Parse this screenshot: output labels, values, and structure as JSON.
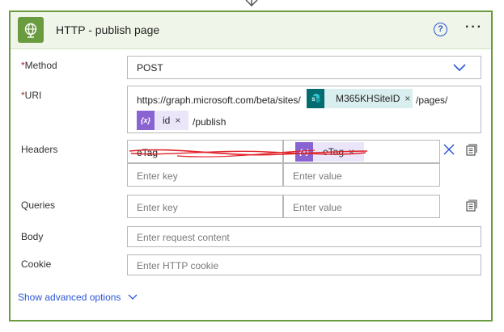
{
  "card": {
    "title": "HTTP - publish page",
    "help_symbol": "?",
    "more_symbol": "···"
  },
  "method": {
    "label": "Method",
    "required_mark": "*",
    "value": "POST"
  },
  "uri": {
    "label": "URI",
    "required_mark": "*",
    "prefix": "https://graph.microsoft.com/beta/sites/",
    "token1": {
      "icon": "sharepoint-icon",
      "text": "M365KHSiteID"
    },
    "middle": "/pages/",
    "token2": {
      "icon": "expression-icon",
      "icon_text": "{x}",
      "text": "id"
    },
    "suffix": "/publish"
  },
  "headers": {
    "label": "Headers",
    "row1": {
      "key": "eTag",
      "value_token": {
        "icon": "expression-icon",
        "icon_text": "{x}",
        "text": "eTag"
      }
    },
    "row2": {
      "key_placeholder": "Enter key",
      "value_placeholder": "Enter value"
    }
  },
  "queries": {
    "label": "Queries",
    "key_placeholder": "Enter key",
    "value_placeholder": "Enter value"
  },
  "body": {
    "label": "Body",
    "placeholder": "Enter request content"
  },
  "cookie": {
    "label": "Cookie",
    "placeholder": "Enter HTTP cookie"
  },
  "advanced": {
    "label": "Show advanced options"
  },
  "token_close_symbol": "×",
  "colors": {
    "card_border": "#6a9b3e",
    "header_bg": "#eff5e8",
    "link_blue": "#2b55d8",
    "strike_red": "#e0242b"
  }
}
